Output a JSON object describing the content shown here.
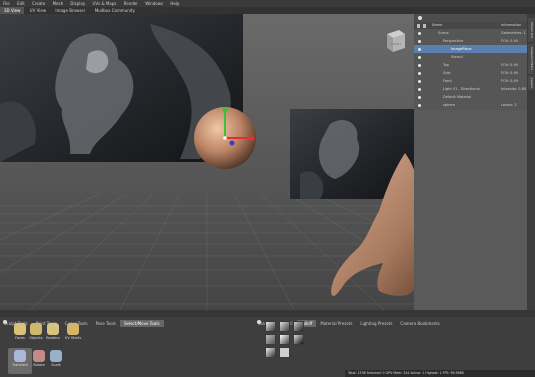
{
  "menu": {
    "items": [
      "File",
      "Edit",
      "Create",
      "Mesh",
      "Display",
      "UVs & Maps",
      "Render",
      "Windows",
      "Help"
    ]
  },
  "view_tabs": [
    "3D View",
    "UV View",
    "Image Browser",
    "Mudbox Community"
  ],
  "viewport": {
    "cube_label": "FRONT"
  },
  "outliner": {
    "col_name": "Name",
    "col_info": "Information",
    "rows": [
      {
        "name": "Scene",
        "info": "Geometries: 1"
      },
      {
        "name": "Perspective",
        "info": "FOV: 0.49"
      },
      {
        "name": "ImagePlane",
        "info": ""
      },
      {
        "name": "Stencil",
        "info": ""
      },
      {
        "name": "Top",
        "info": "FOV: 0.49"
      },
      {
        "name": "Side",
        "info": "FOV: 0.49"
      },
      {
        "name": "Front",
        "info": "FOV: 0.49"
      },
      {
        "name": "Light 01 - Directional",
        "info": "Intensity: 0.80"
      },
      {
        "name": "Default Material",
        "info": ""
      },
      {
        "name": "sphere",
        "info": "Levels: 2"
      }
    ]
  },
  "side_tabs": [
    "Object List",
    "Viewport Filters",
    "Layers"
  ],
  "tool_tabs": [
    "Sculpt Tools",
    "Paint Tools",
    "Curve Tools",
    "Pose Tools",
    "Select/Move Tools"
  ],
  "tools": [
    "Faces",
    "Objects",
    "Borders",
    "UV Shells",
    "Translate",
    "Rotate",
    "Scale"
  ],
  "tray_tabs": [
    "Stamp",
    "Stencil",
    "Falloff",
    "Material Presets",
    "Lighting Presets",
    "Camera Bookmarks"
  ],
  "status": {
    "text": "Total: 1536  Selected: 0  GPU Mem: 244  Active: 1  Highest: 1  FPS: 99.9986"
  },
  "colors": {
    "accent": "#5b7fb1",
    "selected_tab": "#676767"
  }
}
